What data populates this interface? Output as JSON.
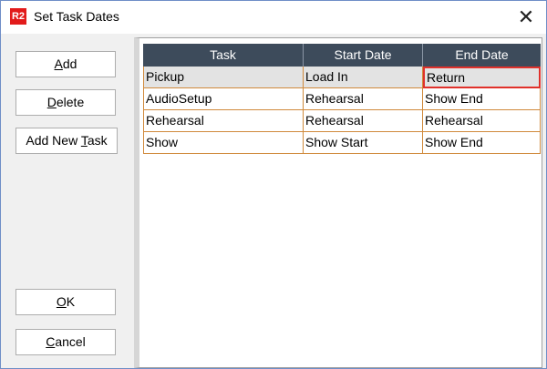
{
  "window": {
    "title": "Set Task Dates",
    "app_icon_text": "R2",
    "close_glyph": "✕"
  },
  "buttons": {
    "add": {
      "pre": "",
      "mnemonic": "A",
      "post": "dd"
    },
    "delete": {
      "pre": "",
      "mnemonic": "D",
      "post": "elete"
    },
    "add_new_task": {
      "pre": "Add New ",
      "mnemonic": "T",
      "post": "ask"
    },
    "ok": {
      "pre": "",
      "mnemonic": "O",
      "post": "K"
    },
    "cancel": {
      "pre": "",
      "mnemonic": "C",
      "post": "ancel"
    }
  },
  "table": {
    "columns": [
      "Task",
      "Start Date",
      "End Date"
    ],
    "rows": [
      [
        "Pickup",
        "Load In",
        "Return"
      ],
      [
        "AudioSetup",
        "Rehearsal",
        "Show End"
      ],
      [
        "Rehearsal",
        "Rehearsal",
        "Rehearsal"
      ],
      [
        "Show",
        "Show Start",
        "Show End"
      ]
    ]
  },
  "colors": {
    "header_bg": "#3d4b5b",
    "cell_border": "#d08a3c",
    "focus_border": "#e0312b",
    "app_icon_bg": "#e21b1b"
  }
}
